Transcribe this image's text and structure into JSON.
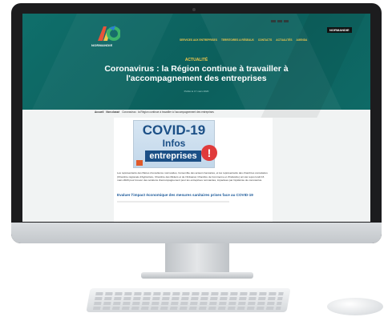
{
  "site": {
    "logo_text": "NORMANDIE",
    "nav": [
      "SERVICES AUX ENTREPRISES",
      "TERRITOIRES & RÉSEAUX",
      "CONTACTS",
      "ACTUALITÉS",
      "AGENDA"
    ],
    "region_badge": "NORMANDIE"
  },
  "hero": {
    "category": "ACTUALITÉ",
    "title": "Coronavirus : la Région continue à travailler à l'accompagnement des entreprises",
    "date": "Publié le 17 mars 2020"
  },
  "breadcrumb": {
    "home": "Accueil",
    "section": "Non classé",
    "current": "Coronavirus : la Région continue à travailler à l'accompagnement des entreprises"
  },
  "article": {
    "image": {
      "line1": "COVID-19",
      "line2": "Infos",
      "line3": "entreprises",
      "warning_glyph": "!"
    },
    "paragraph": "Les représentants des filières d'excellence normandes, l'ensemble des acteurs bancaires, et les représentants des chambres consulaires (Chambre régionale d'Agriculture, Chambre des Métiers et de l'Artisanat, Chambre de Commerce et d'Industrie) ont été reçus lundi 16 mars 2020 pour trouver des solutions d'accompagnement pour les entreprises normandes, impactées par l'épidémie de coronavirus.",
    "subheading": "Evaluer l'impact économique des mesures sanitaires prises face au COVID-19"
  },
  "colors": {
    "hero_teal": "#0f6f6b",
    "accent_yellow": "#f2c94c",
    "brand_blue": "#1b4f86",
    "warning_red": "#e03b3b"
  }
}
